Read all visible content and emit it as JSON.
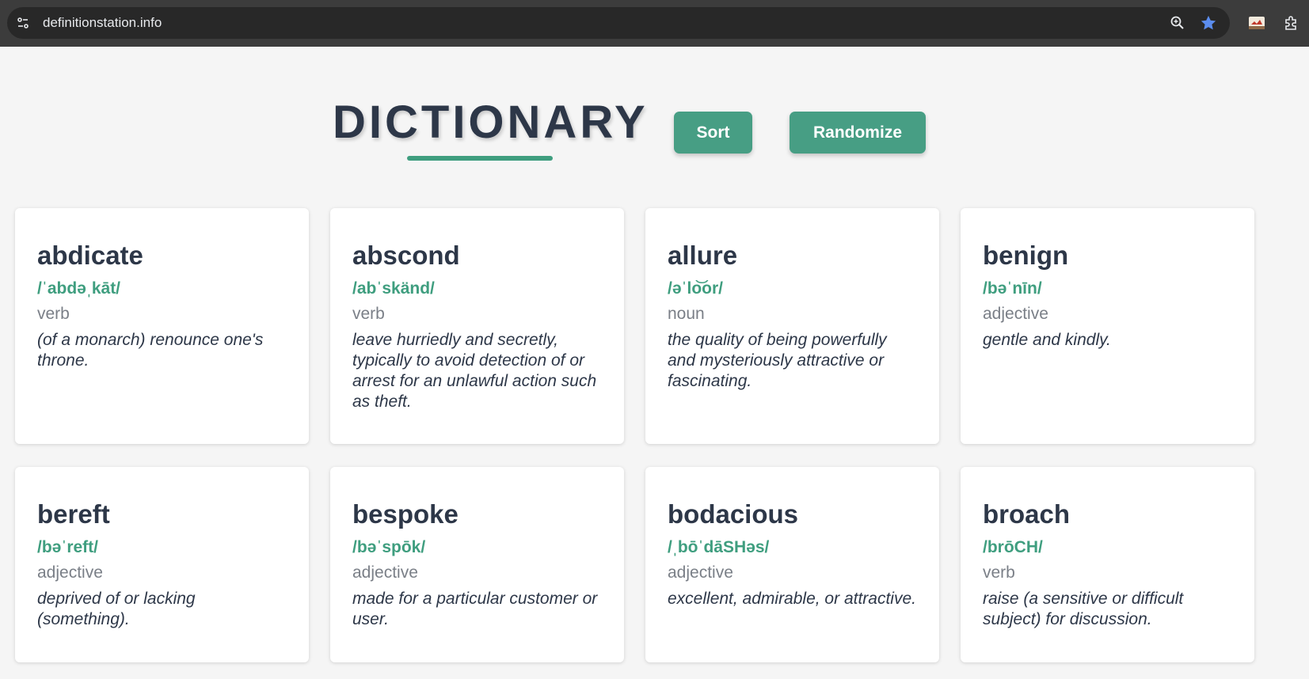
{
  "browser": {
    "url": "definitionstation.info"
  },
  "header": {
    "title": "DICTIONARY",
    "sort_label": "Sort",
    "randomize_label": "Randomize"
  },
  "colors": {
    "accent": "#479e84",
    "title": "#2d3748",
    "pos": "#7a7f87"
  },
  "cards": [
    {
      "word": "abdicate",
      "pronunciation": "/ˈabdəˌkāt/",
      "part_of_speech": "verb",
      "definition": "(of a monarch) renounce one's throne."
    },
    {
      "word": "abscond",
      "pronunciation": "/abˈskänd/",
      "part_of_speech": "verb",
      "definition": "leave hurriedly and secretly, typically to avoid detection of or arrest for an unlawful action such as theft."
    },
    {
      "word": "allure",
      "pronunciation": "/əˈlo͝or/",
      "part_of_speech": "noun",
      "definition": "the quality of being powerfully and mysteriously attractive or fascinating."
    },
    {
      "word": "benign",
      "pronunciation": "/bəˈnīn/",
      "part_of_speech": "adjective",
      "definition": "gentle and kindly."
    },
    {
      "word": "bereft",
      "pronunciation": "/bəˈreft/",
      "part_of_speech": "adjective",
      "definition": "deprived of or lacking (something)."
    },
    {
      "word": "bespoke",
      "pronunciation": "/bəˈspōk/",
      "part_of_speech": "adjective",
      "definition": "made for a particular customer or user."
    },
    {
      "word": "bodacious",
      "pronunciation": "/ˌbōˈdāSHəs/",
      "part_of_speech": "adjective",
      "definition": "excellent, admirable, or attractive."
    },
    {
      "word": "broach",
      "pronunciation": "/brōCH/",
      "part_of_speech": "verb",
      "definition": "raise (a sensitive or difficult subject) for discussion."
    }
  ]
}
